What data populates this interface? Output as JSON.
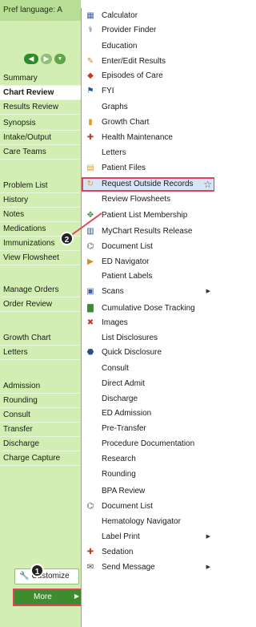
{
  "sidebar": {
    "pref_language": "Pref language: A",
    "tabs": [
      {
        "label": "Summary",
        "active": false
      },
      {
        "label": "Chart Review",
        "active": true
      },
      {
        "label": "Results Review",
        "active": false
      },
      {
        "label": "Synopsis",
        "active": false
      },
      {
        "label": "Intake/Output",
        "active": false
      },
      {
        "label": "Care Teams",
        "active": false
      },
      {
        "label": "Problem List",
        "active": false
      },
      {
        "label": "History",
        "active": false
      },
      {
        "label": "Notes",
        "active": false
      },
      {
        "label": "Medications",
        "active": false
      },
      {
        "label": "Immunizations",
        "active": false
      },
      {
        "label": "View Flowsheet",
        "active": false
      },
      {
        "label": "Manage Orders",
        "active": false
      },
      {
        "label": "Order Review",
        "active": false
      },
      {
        "label": "Growth Chart",
        "active": false
      },
      {
        "label": "Letters",
        "active": false
      },
      {
        "label": "Admission",
        "active": false
      },
      {
        "label": "Rounding",
        "active": false
      },
      {
        "label": "Consult",
        "active": false
      },
      {
        "label": "Transfer",
        "active": false
      },
      {
        "label": "Discharge",
        "active": false
      },
      {
        "label": "Charge Capture",
        "active": false
      }
    ],
    "customize_label": "Customize",
    "more_label": "More"
  },
  "menu": {
    "items": [
      {
        "label": "Calculator",
        "icon": "calculator-icon",
        "glyph": "▦",
        "color": "#3a5fa8"
      },
      {
        "label": "Provider Finder",
        "icon": "provider-finder-icon",
        "glyph": "⚕",
        "color": "#2b4f8a"
      },
      {
        "label": "Education",
        "icon": "",
        "glyph": "",
        "color": ""
      },
      {
        "label": "Enter/Edit Results",
        "icon": "pencil-icon",
        "glyph": "✎",
        "color": "#d88a1a"
      },
      {
        "label": "Episodes of Care",
        "icon": "episodes-icon",
        "glyph": "◆",
        "color": "#c0392b"
      },
      {
        "label": "FYI",
        "icon": "flag-icon",
        "glyph": "⚑",
        "color": "#2455a4"
      },
      {
        "label": "Graphs",
        "icon": "",
        "glyph": "",
        "color": ""
      },
      {
        "label": "Growth Chart",
        "icon": "growth-chart-icon",
        "glyph": "▮",
        "color": "#e0a020"
      },
      {
        "label": "Health Maintenance",
        "icon": "health-maintenance-icon",
        "glyph": "✚",
        "color": "#c0392b"
      },
      {
        "label": "Letters",
        "icon": "",
        "glyph": "",
        "color": ""
      },
      {
        "label": "Patient Files",
        "icon": "patient-files-icon",
        "glyph": "▤",
        "color": "#d8a020"
      },
      {
        "label": "Request Outside Records",
        "icon": "request-records-icon",
        "glyph": "↻",
        "color": "#d8a020",
        "highlighted": true
      },
      {
        "label": "Review Flowsheets",
        "icon": "",
        "glyph": "",
        "color": ""
      },
      {
        "label": "Patient List Membership",
        "icon": "patient-list-icon",
        "glyph": "✥",
        "color": "#3a8a3a"
      },
      {
        "label": "MyChart Results Release",
        "icon": "mychart-icon",
        "glyph": "▥",
        "color": "#2b4f8a"
      },
      {
        "label": "Document List",
        "icon": "document-list-icon",
        "glyph": "⌬",
        "color": "#555555"
      },
      {
        "label": "ED Navigator",
        "icon": "ed-navigator-icon",
        "glyph": "▶",
        "color": "#d88a1a"
      },
      {
        "label": "Patient Labels",
        "icon": "",
        "glyph": "",
        "color": ""
      },
      {
        "label": "Scans",
        "icon": "scans-icon",
        "glyph": "▣",
        "color": "#3a5fa8",
        "submenu": true
      },
      {
        "label": "Cumulative Dose Tracking",
        "icon": "dose-tracking-icon",
        "glyph": "▇",
        "color": "#3a8a3a"
      },
      {
        "label": "Images",
        "icon": "images-icon",
        "glyph": "✖",
        "color": "#c0392b"
      },
      {
        "label": "List Disclosures",
        "icon": "",
        "glyph": "",
        "color": ""
      },
      {
        "label": "Quick Disclosure",
        "icon": "quick-disclosure-icon",
        "glyph": "⬣",
        "color": "#2b4f8a"
      },
      {
        "label": "Consult",
        "icon": "",
        "glyph": "",
        "color": ""
      },
      {
        "label": "Direct Admit",
        "icon": "",
        "glyph": "",
        "color": ""
      },
      {
        "label": "Discharge",
        "icon": "",
        "glyph": "",
        "color": ""
      },
      {
        "label": "ED Admission",
        "icon": "",
        "glyph": "",
        "color": ""
      },
      {
        "label": "Pre-Transfer",
        "icon": "",
        "glyph": "",
        "color": ""
      },
      {
        "label": "Procedure Documentation",
        "icon": "",
        "glyph": "",
        "color": ""
      },
      {
        "label": "Research",
        "icon": "",
        "glyph": "",
        "color": ""
      },
      {
        "label": "Rounding",
        "icon": "",
        "glyph": "",
        "color": ""
      },
      {
        "label": "BPA Review",
        "icon": "",
        "glyph": "",
        "color": ""
      },
      {
        "label": "Document List",
        "icon": "document-list-icon",
        "glyph": "⌬",
        "color": "#555555"
      },
      {
        "label": "Hematology Navigator",
        "icon": "",
        "glyph": "",
        "color": ""
      },
      {
        "label": "Label Print",
        "icon": "",
        "glyph": "",
        "color": "",
        "submenu": true
      },
      {
        "label": "Sedation",
        "icon": "sedation-icon",
        "glyph": "✚",
        "color": "#c0392b"
      },
      {
        "label": "Send Message",
        "icon": "envelope-icon",
        "glyph": "✉",
        "color": "#444444",
        "submenu": true
      }
    ]
  },
  "callouts": {
    "step_1": "1",
    "step_2": "2"
  },
  "colors": {
    "sidebar_bg": "#d3eeb2",
    "more_button_bg": "#3d8c2e",
    "highlight_border": "#e2425b",
    "highlight_bg": "#d6e6f7"
  }
}
